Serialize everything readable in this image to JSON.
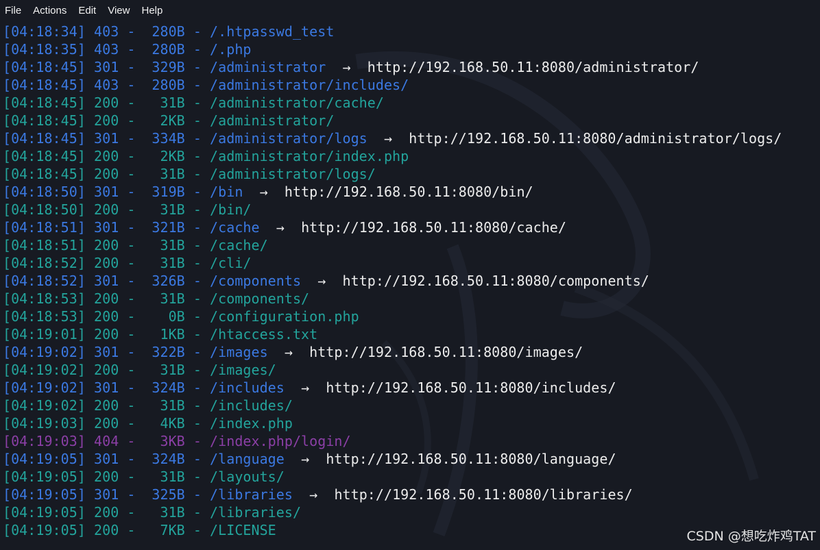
{
  "menu": [
    "File",
    "Actions",
    "Edit",
    "View",
    "Help"
  ],
  "colors": {
    "background": "#171a22",
    "status_403_301": "#3b79e2",
    "status_200": "#23a49c",
    "status_404": "#8b3fa6",
    "redirect_text": "#ececec"
  },
  "lines": [
    {
      "time": "[04:18:34]",
      "status": "403",
      "size": "280B",
      "path": "/.htpasswd_test",
      "redirect": "",
      "color": "blue"
    },
    {
      "time": "[04:18:35]",
      "status": "403",
      "size": "280B",
      "path": "/.php",
      "redirect": "",
      "color": "blue"
    },
    {
      "time": "[04:18:45]",
      "status": "301",
      "size": "329B",
      "path": "/administrator",
      "redirect": "http://192.168.50.11:8080/administrator/",
      "color": "blue"
    },
    {
      "time": "[04:18:45]",
      "status": "403",
      "size": "280B",
      "path": "/administrator/includes/",
      "redirect": "",
      "color": "blue"
    },
    {
      "time": "[04:18:45]",
      "status": "200",
      "size": "31B",
      "path": "/administrator/cache/",
      "redirect": "",
      "color": "teal"
    },
    {
      "time": "[04:18:45]",
      "status": "200",
      "size": "2KB",
      "path": "/administrator/",
      "redirect": "",
      "color": "teal"
    },
    {
      "time": "[04:18:45]",
      "status": "301",
      "size": "334B",
      "path": "/administrator/logs",
      "redirect": "http://192.168.50.11:8080/administrator/logs/",
      "color": "blue"
    },
    {
      "time": "[04:18:45]",
      "status": "200",
      "size": "2KB",
      "path": "/administrator/index.php",
      "redirect": "",
      "color": "teal"
    },
    {
      "time": "[04:18:45]",
      "status": "200",
      "size": "31B",
      "path": "/administrator/logs/",
      "redirect": "",
      "color": "teal"
    },
    {
      "time": "[04:18:50]",
      "status": "301",
      "size": "319B",
      "path": "/bin",
      "redirect": "http://192.168.50.11:8080/bin/",
      "color": "blue"
    },
    {
      "time": "[04:18:50]",
      "status": "200",
      "size": "31B",
      "path": "/bin/",
      "redirect": "",
      "color": "teal"
    },
    {
      "time": "[04:18:51]",
      "status": "301",
      "size": "321B",
      "path": "/cache",
      "redirect": "http://192.168.50.11:8080/cache/",
      "color": "blue"
    },
    {
      "time": "[04:18:51]",
      "status": "200",
      "size": "31B",
      "path": "/cache/",
      "redirect": "",
      "color": "teal"
    },
    {
      "time": "[04:18:52]",
      "status": "200",
      "size": "31B",
      "path": "/cli/",
      "redirect": "",
      "color": "teal"
    },
    {
      "time": "[04:18:52]",
      "status": "301",
      "size": "326B",
      "path": "/components",
      "redirect": "http://192.168.50.11:8080/components/",
      "color": "blue"
    },
    {
      "time": "[04:18:53]",
      "status": "200",
      "size": "31B",
      "path": "/components/",
      "redirect": "",
      "color": "teal"
    },
    {
      "time": "[04:18:53]",
      "status": "200",
      "size": "0B",
      "path": "/configuration.php",
      "redirect": "",
      "color": "teal"
    },
    {
      "time": "[04:19:01]",
      "status": "200",
      "size": "1KB",
      "path": "/htaccess.txt",
      "redirect": "",
      "color": "teal"
    },
    {
      "time": "[04:19:02]",
      "status": "301",
      "size": "322B",
      "path": "/images",
      "redirect": "http://192.168.50.11:8080/images/",
      "color": "blue"
    },
    {
      "time": "[04:19:02]",
      "status": "200",
      "size": "31B",
      "path": "/images/",
      "redirect": "",
      "color": "teal"
    },
    {
      "time": "[04:19:02]",
      "status": "301",
      "size": "324B",
      "path": "/includes",
      "redirect": "http://192.168.50.11:8080/includes/",
      "color": "blue"
    },
    {
      "time": "[04:19:02]",
      "status": "200",
      "size": "31B",
      "path": "/includes/",
      "redirect": "",
      "color": "teal"
    },
    {
      "time": "[04:19:03]",
      "status": "200",
      "size": "4KB",
      "path": "/index.php",
      "redirect": "",
      "color": "teal"
    },
    {
      "time": "[04:19:03]",
      "status": "404",
      "size": "3KB",
      "path": "/index.php/login/",
      "redirect": "",
      "color": "purple"
    },
    {
      "time": "[04:19:05]",
      "status": "301",
      "size": "324B",
      "path": "/language",
      "redirect": "http://192.168.50.11:8080/language/",
      "color": "blue"
    },
    {
      "time": "[04:19:05]",
      "status": "200",
      "size": "31B",
      "path": "/layouts/",
      "redirect": "",
      "color": "teal"
    },
    {
      "time": "[04:19:05]",
      "status": "301",
      "size": "325B",
      "path": "/libraries",
      "redirect": "http://192.168.50.11:8080/libraries/",
      "color": "blue"
    },
    {
      "time": "[04:19:05]",
      "status": "200",
      "size": "31B",
      "path": "/libraries/",
      "redirect": "",
      "color": "teal"
    },
    {
      "time": "[04:19:05]",
      "status": "200",
      "size": "7KB",
      "path": "/LICENSE",
      "redirect": "",
      "color": "teal"
    }
  ],
  "arrow": "→",
  "watermark": "CSDN @想吃炸鸡TAT"
}
